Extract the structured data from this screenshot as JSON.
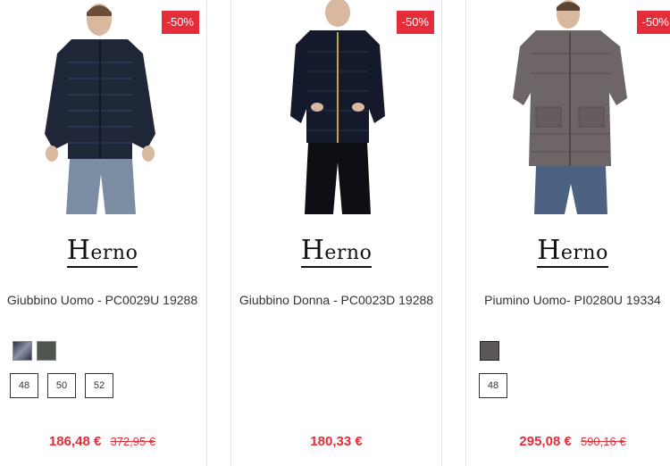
{
  "products": [
    {
      "discount": "-50%",
      "brand": "Herno",
      "name": "Giubbino Uomo - PC0029U 19288",
      "swatch_colors": [
        "#4a4f66",
        "#4f5650"
      ],
      "sizes": [
        "48",
        "50",
        "52"
      ],
      "price": "186,48 €",
      "old_price": "372,95 €"
    },
    {
      "discount": "-50%",
      "brand": "Herno",
      "name": "Giubbino Donna - PC0023D 19288",
      "swatch_colors": [],
      "sizes": [],
      "price": "180,33 €",
      "old_price": ""
    },
    {
      "discount": "-50%",
      "brand": "Herno",
      "name": "Piumino Uomo- PI0280U 19334",
      "swatch_colors": [
        "#5b5658"
      ],
      "sizes": [
        "48"
      ],
      "price": "295,08 €",
      "old_price": "590,16 €"
    }
  ]
}
